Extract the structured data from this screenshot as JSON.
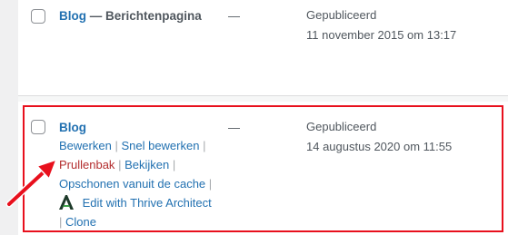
{
  "rows": [
    {
      "title": "Blog",
      "title_suffix": "— Berichtenpagina",
      "author_placeholder": "—",
      "status": "Gepubliceerd",
      "date": "11 november 2015 om 13:17"
    },
    {
      "title": "Blog",
      "author_placeholder": "—",
      "status": "Gepubliceerd",
      "date": "14 augustus 2020 om 11:55",
      "actions": {
        "edit": "Bewerken",
        "quick_edit": "Snel bewerken",
        "trash": "Prullenbak",
        "view": "Bekijken",
        "purge_cache": "Opschonen vanuit de cache",
        "thrive": "Edit with Thrive Architect",
        "clone": "Clone",
        "separator": "|"
      }
    }
  ],
  "colors": {
    "link": "#2271b1",
    "trash": "#b32d2e",
    "highlight": "#e8101d",
    "gutter": "#f0f0f1"
  },
  "icons": [
    "thrive-architect-icon",
    "red-arrow-icon"
  ]
}
